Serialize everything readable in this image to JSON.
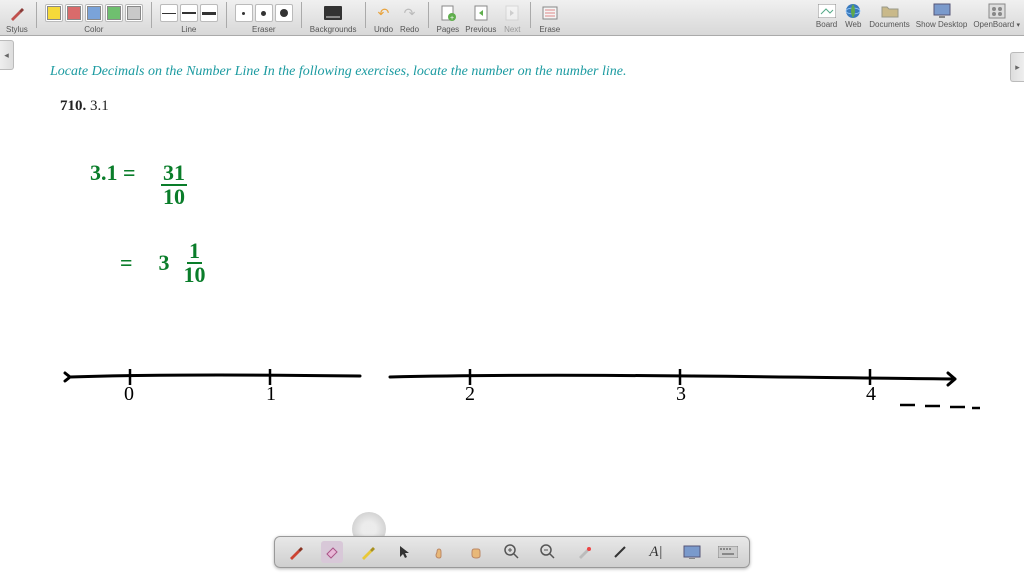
{
  "toolbar": {
    "stylus_label": "Stylus",
    "color_label": "Color",
    "colors": [
      "#f5d93a",
      "#d96b6b",
      "#7aa3d9",
      "#6fbf6f",
      "#c9c9c9"
    ],
    "line_label": "Line",
    "eraser_label": "Eraser",
    "backgrounds_label": "Backgrounds",
    "undo_label": "Undo",
    "redo_label": "Redo",
    "pages_label": "Pages",
    "previous_label": "Previous",
    "next_label": "Next",
    "erase_label": "Erase"
  },
  "right": {
    "board": "Board",
    "web": "Web",
    "documents": "Documents",
    "showdesktop": "Show Desktop",
    "openboard": "OpenBoard"
  },
  "content": {
    "instruction": "Locate Decimals on the Number Line In the following exercises, locate the number on the number line.",
    "problem_num": "710.",
    "problem_val": "3.1",
    "work": {
      "lhs": "3.1 =",
      "frac_n": "31",
      "frac_d": "10",
      "eq": "=",
      "whole": "3",
      "mix_n": "1",
      "mix_d": "10"
    },
    "numberline_labels": [
      "0",
      "1",
      "2",
      "3",
      "4"
    ]
  },
  "bottombar": {
    "tools": [
      "pen",
      "eraser",
      "highlighter",
      "pointer",
      "hand-open",
      "hand-grab",
      "zoom-in",
      "zoom-out",
      "laser",
      "line",
      "text",
      "capture",
      "keyboard"
    ]
  }
}
